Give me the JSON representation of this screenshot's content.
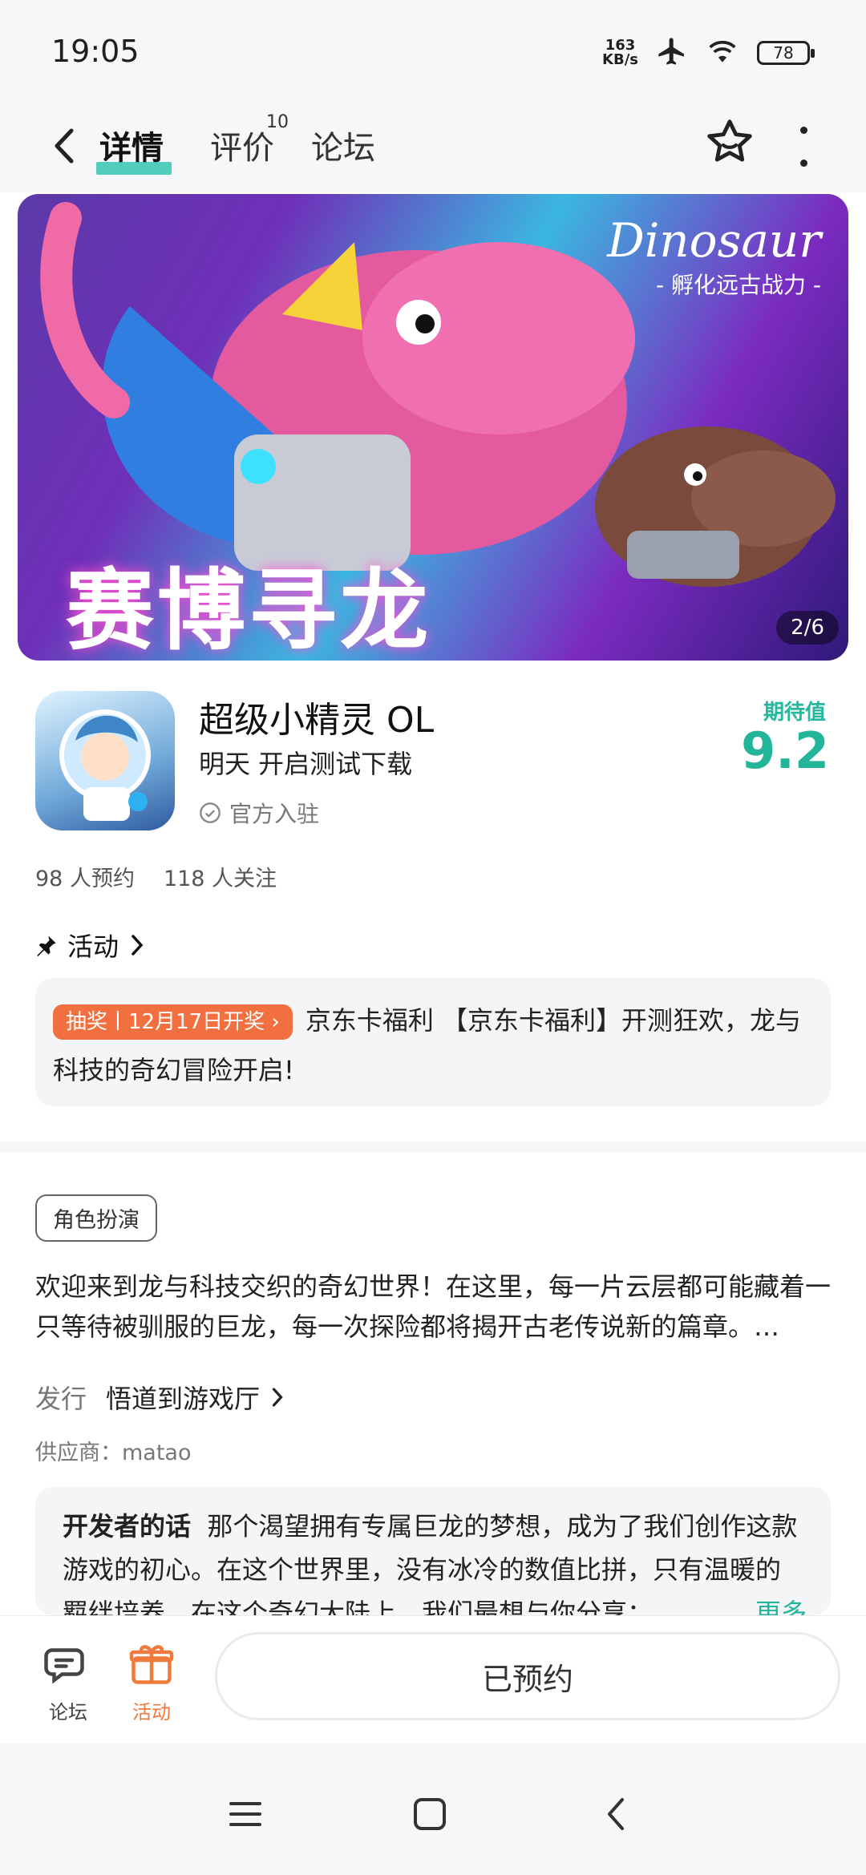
{
  "status": {
    "time": "19:05",
    "net_speed_value": "163",
    "net_speed_unit": "KB/s",
    "battery": "78"
  },
  "nav": {
    "tabs": [
      {
        "label": "详情"
      },
      {
        "label": "评价"
      },
      {
        "label": "论坛"
      }
    ],
    "rating_badge": "10"
  },
  "banner": {
    "title_text": "赛博寻龙",
    "brand_en": "Dinosaur",
    "brand_zh": "- 孵化远古战力 -",
    "page_indicator": "2/6"
  },
  "app": {
    "name": "超级小精灵 OL",
    "release": "明天 开启测试下载",
    "official": "官方入驻",
    "expect_label": "期待值",
    "expect_value": "9.2"
  },
  "stats": {
    "reservations": "98 人预约",
    "followers": "118 人关注"
  },
  "activity": {
    "header": "活动",
    "tag": "抽奖丨12月17日开奖 ›",
    "text": "京东卡福利 【京东卡福利】开测狂欢，龙与科技的奇幻冒险开启!"
  },
  "details": {
    "genre": "角色扮演",
    "description": "欢迎来到龙与科技交织的奇幻世界！在这里，每一片云层都可能藏着一只等待被驯服的巨龙，每一次探险都将揭开古老传说新的篇章。…",
    "publisher_label": "发行",
    "publisher_name": "悟道到游戏厅",
    "supplier": "供应商：matao"
  },
  "developer": {
    "label": "开发者的话",
    "text": "那个渴望拥有专属巨龙的梦想，成为了我们创作这款游戏的初心。在这个世界里，没有冰冷的数值比拼，只有温暖的羁绊培养。在这个奇幻大陆上，我们最想与你分享：",
    "more": "更多"
  },
  "bottom": {
    "forum": "论坛",
    "activity": "活动",
    "reserved_button": "已预约"
  },
  "colors": {
    "accent": "#22b59a",
    "tag": "#f2703f",
    "activity_icon": "#f07a3c"
  }
}
